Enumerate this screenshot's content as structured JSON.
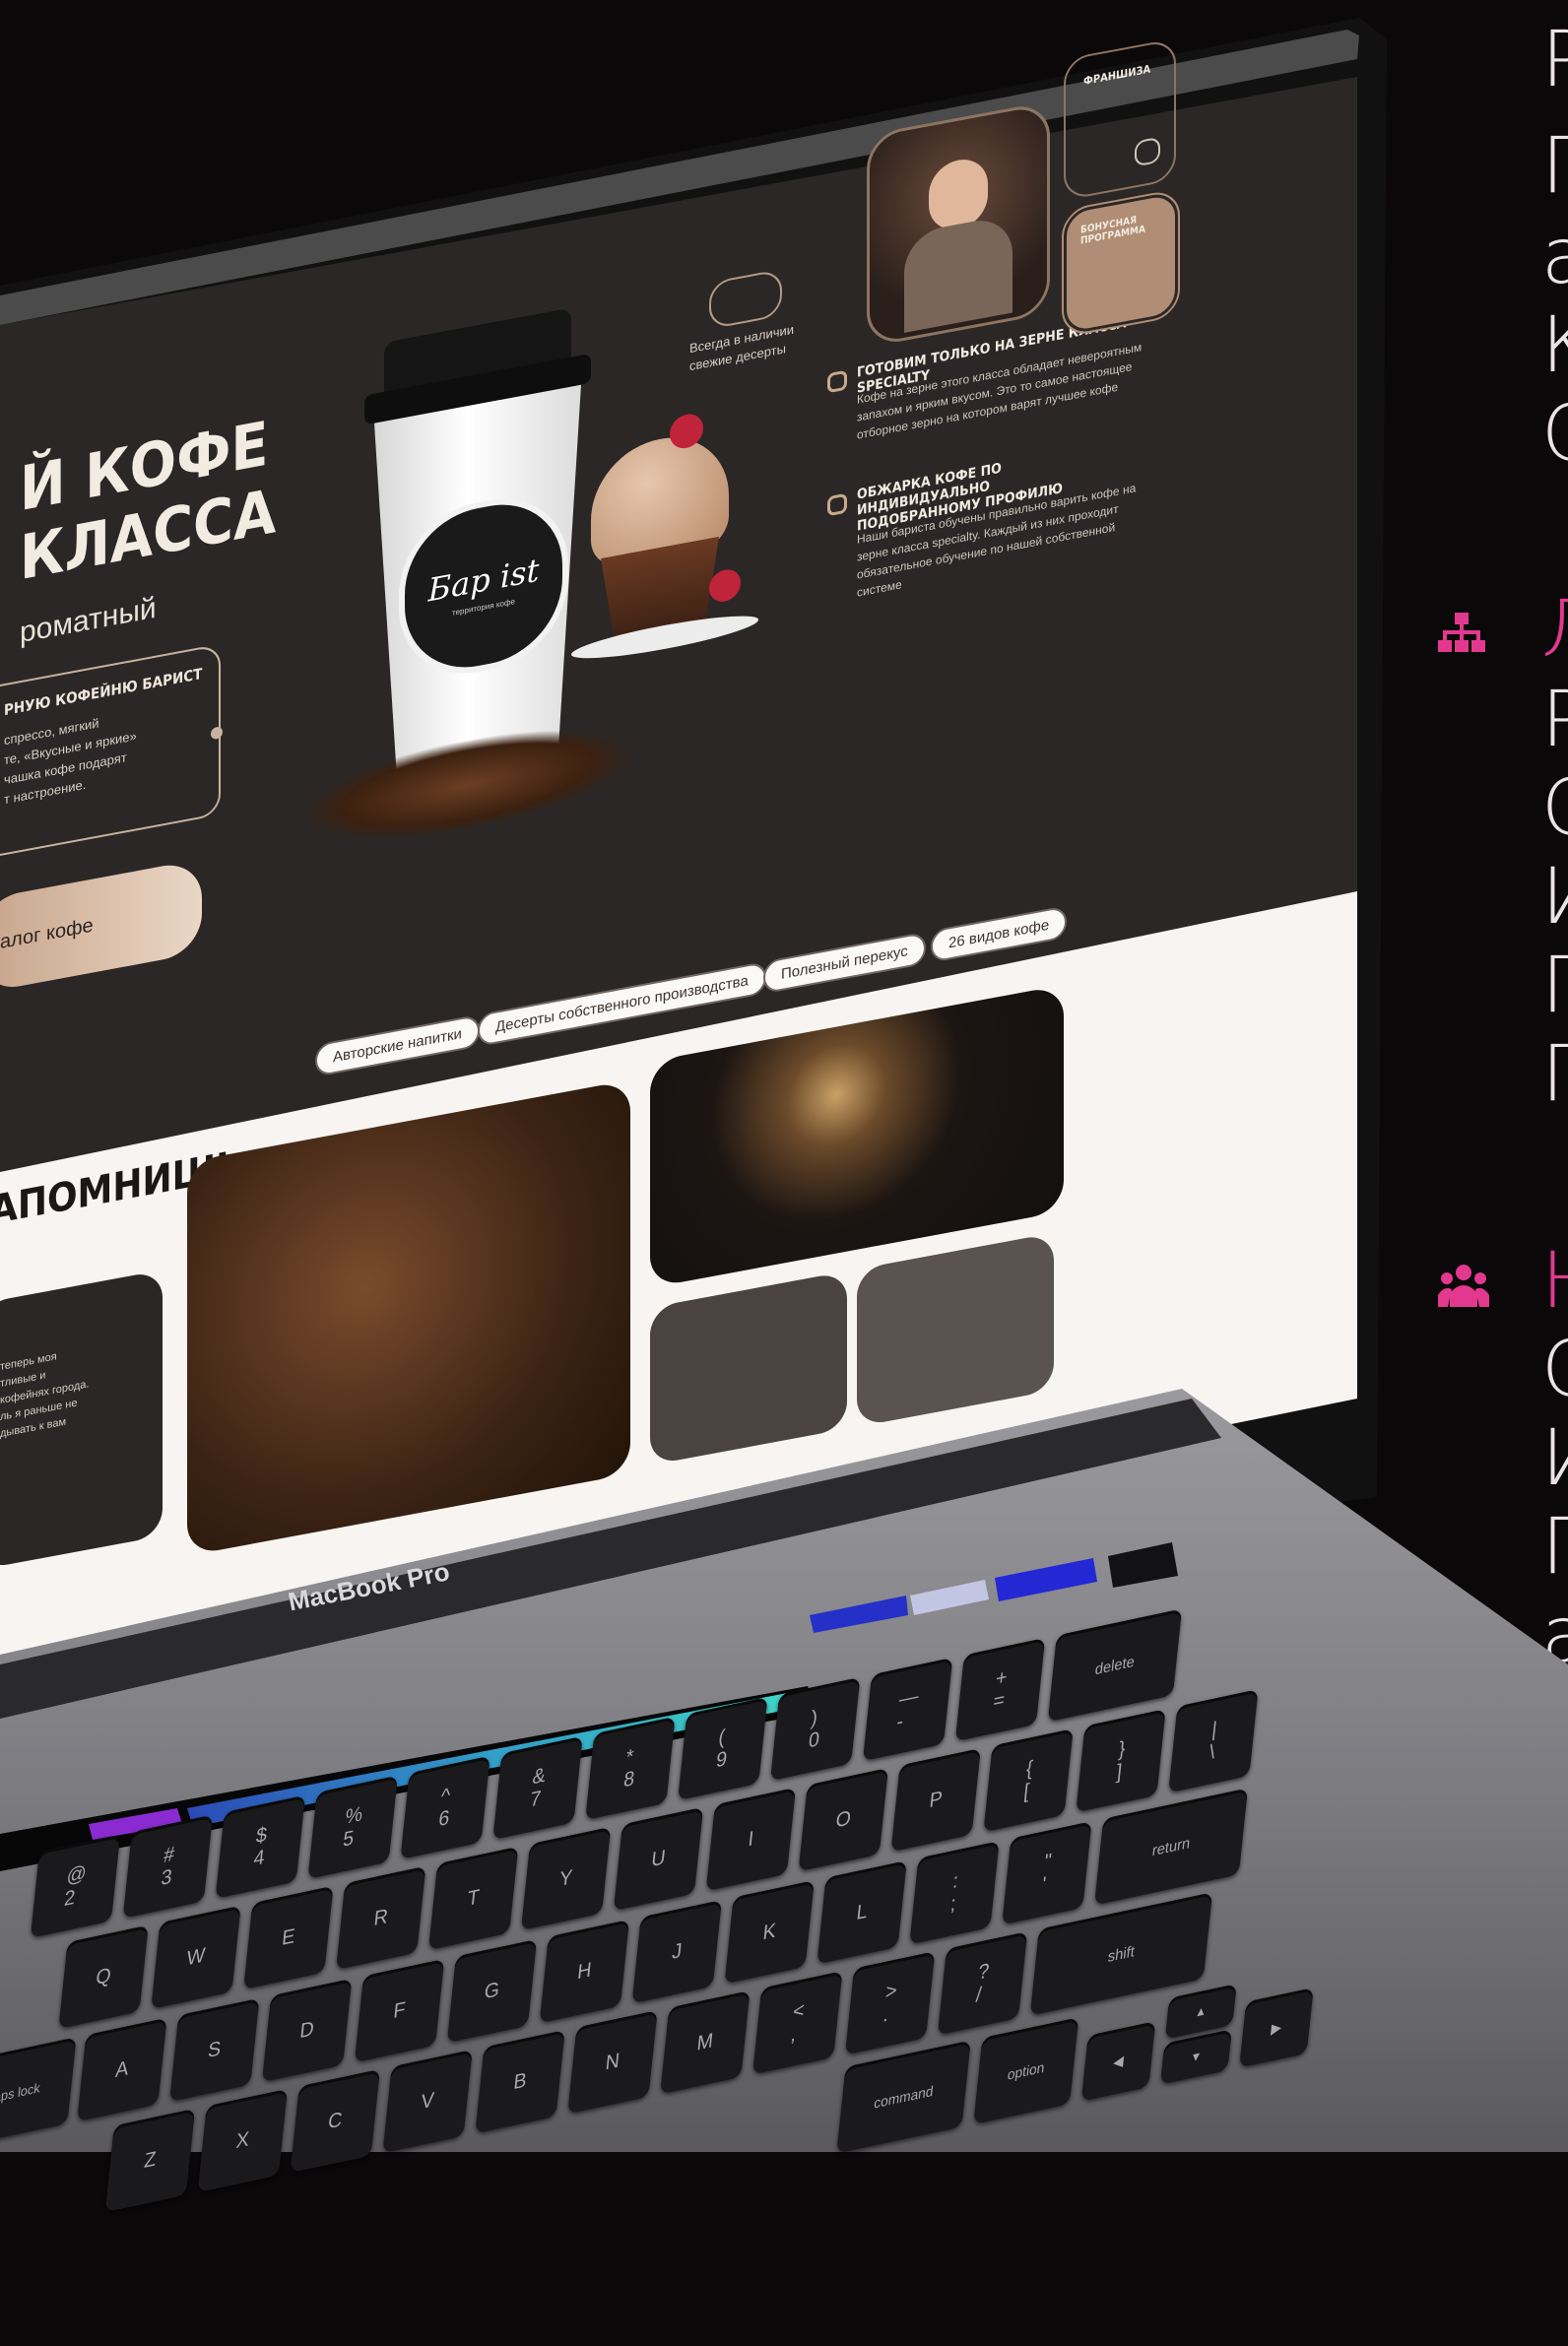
{
  "side": {
    "block1_letters": [
      "Р",
      "П",
      "а",
      "К",
      "С"
    ],
    "block2_letters": [
      "Л",
      "Р",
      "С",
      "И",
      "П",
      "П"
    ],
    "block3_letters": [
      "Н",
      "С",
      "И",
      "П",
      "а"
    ],
    "icon2": "sitemap-icon",
    "icon3": "users-icon"
  },
  "hero": {
    "title_line1": "Й КОФЕ",
    "title_line2": "КЛАССА",
    "subtitle": "роматный",
    "card_title": "РНУЮ КОФЕЙНЮ БАРИСТ",
    "card_text": "спрессо, мягкий\nте, «Вкусные и яркие»\nчашка кофе подарят\nт настроение.",
    "catalog_button": "алог кофе",
    "cup_logo": "Бар ist",
    "cup_sub": "территория кофе",
    "dessert_badge": "Всегда в наличии свежие десерты",
    "feature1_title": "ГОТОВИМ ТОЛЬКО НА ЗЕРНЕ КЛАССА SPECIALTY",
    "feature1_text": "Кофе на зерне этого класса обладает невероятным запахом и ярким вкусом. Это то самое настоящее отборное зерно на котором варят лучшее кофе",
    "feature2_title": "ОБЖАРКА КОФЕ ПО ИНДИВИДУАЛЬНО ПОДОБРАННОМУ ПРОФИЛЮ",
    "feature2_text": "Наши бариста обучены правильно варить кофе на зерне класса specialty. Каждый из них проходит обязательное обучение по нашей собственной системе",
    "franchise": "ФРАНШИЗА",
    "bonus": "БОНУСНАЯ ПРОГРАММА"
  },
  "section2": {
    "title": "АПОМНИШЬ",
    "tags": [
      "Авторские напитки",
      "Десерты собственного производства",
      "Полезный перекус",
      "26 видов кофе"
    ],
    "review_text": "теперь моя\nтливые и\n кофейнях города.\nль я раньше не\nдывать к вам"
  },
  "laptop": {
    "brand": "MacBook Pro",
    "keys_row1": [
      "@\n2",
      "#\n3",
      "$\n4",
      "%\n5",
      "^\n6",
      "&\n7",
      "*\n8",
      "(\n9",
      ")\n0",
      "—\n-",
      "+\n=",
      "delete"
    ],
    "keys_row2": [
      "Q",
      "W",
      "E",
      "R",
      "T",
      "Y",
      "U",
      "I",
      "O",
      "P",
      "{\n[",
      "}\n]",
      "|\n\\"
    ],
    "keys_row3": [
      "A",
      "S",
      "D",
      "F",
      "G",
      "H",
      "J",
      "K",
      "L",
      ":\n;",
      "\"\n'",
      "return"
    ],
    "keys_row4": [
      "Z",
      "X",
      "C",
      "V",
      "B",
      "N",
      "M",
      "<\n,",
      ">\n.",
      "?\n/",
      "shift"
    ],
    "mod_keys": [
      "caps lock",
      "command",
      "option"
    ]
  },
  "colors": {
    "background": "#0b0809",
    "accent": "#e2398f",
    "screen_dark": "#2b2726",
    "screen_light": "#f7f4f1",
    "tan": "#b59079"
  }
}
